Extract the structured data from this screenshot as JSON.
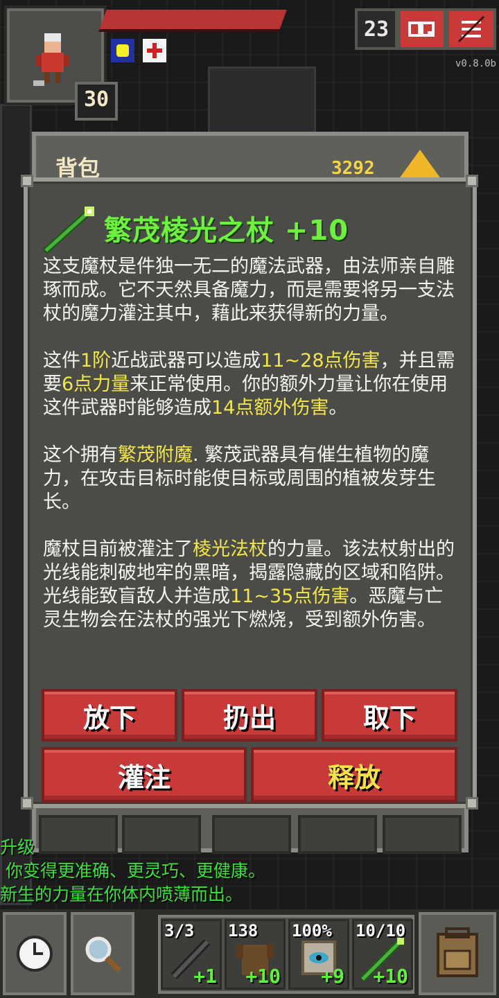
{
  "hud": {
    "hero_level": "30",
    "depth": "23",
    "version": "v0.8.0b",
    "journal_icon": "journal-icon",
    "menu_icon": "menu-icon"
  },
  "backpack": {
    "title": "背包",
    "gold": "3292"
  },
  "item": {
    "name": "繁茂棱光之杖 +10",
    "para1": "这支魔杖是件独一无二的魔法武器，由法师亲自雕琢而成。它不天然具备魔力，而是需要将另一支法杖的魔力灌注其中，藉此来获得新的力量。",
    "para2": {
      "t1": "这件",
      "tier": "1阶",
      "t2": "近战武器可以造成",
      "damage": "11~28点伤害",
      "t3": "，并且需要",
      "str": "6点力量",
      "t4": "来正常使用。你的额外力量让你在使用这件武器时能够造成",
      "bonus": "14点额外伤害",
      "t5": "。"
    },
    "para3": {
      "t1": "这个拥有",
      "enchant": "繁茂附魔",
      "t2": ". 繁茂武器具有催生植物的魔力，在攻击目标时能使目标或周围的植被发芽生长。"
    },
    "para4": {
      "t1": "魔杖目前被灌注了",
      "wand": "棱光法杖",
      "t2": "的力量。该法杖射出的光线能刺破地牢的黑暗，揭露隐藏的区域和陷阱。光线能致盲敌人并造成",
      "damage": "11~35点伤害",
      "t3": "。恶魔与亡灵生物会在法杖的强光下燃烧，受到额外伤害。"
    }
  },
  "actions": {
    "drop": "放下",
    "throw": "扔出",
    "unequip": "取下",
    "imbue": "灌注",
    "zap": "释放"
  },
  "log": {
    "line1": "升级",
    "line2": " 你变得更准确、更灵巧、更健康。",
    "line3": "新生的力量在你体内喷薄而出。"
  },
  "quickslots": [
    {
      "top": "3/3",
      "bottom": "+1",
      "icon": "wand-icon"
    },
    {
      "top": "138",
      "bottom": "+10",
      "icon": "armor-icon"
    },
    {
      "top": "100%",
      "bottom": "+9",
      "icon": "artifact-icon"
    },
    {
      "top": "10/10",
      "bottom": "+10",
      "icon": "magic-staff-icon"
    }
  ],
  "colors": {
    "item_name": "#6ef03f",
    "highlight": "#f3e64a",
    "button": "#c8393a",
    "log": "#39e03a"
  }
}
